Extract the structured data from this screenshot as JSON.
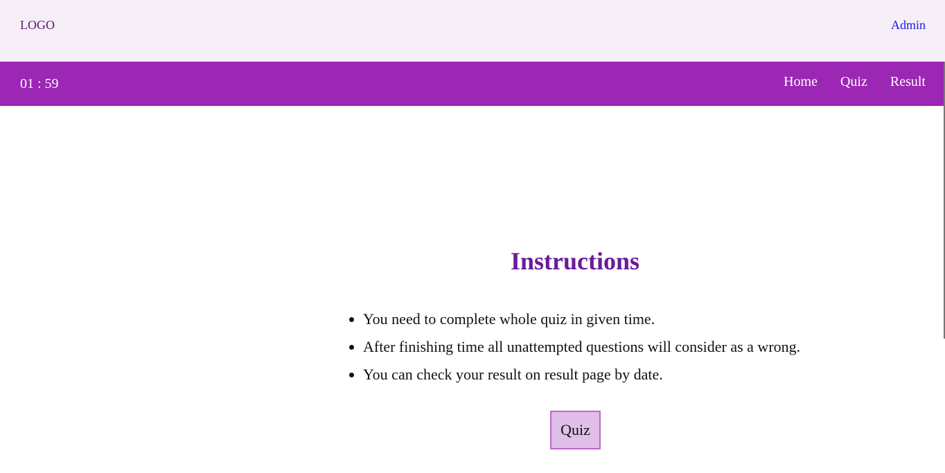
{
  "header": {
    "logo_text": "LOGO",
    "admin_link": "Admin"
  },
  "navbar": {
    "timer": "01 : 59",
    "links": [
      {
        "label": "Home"
      },
      {
        "label": "Quiz"
      },
      {
        "label": "Result"
      }
    ]
  },
  "main": {
    "title": "Instructions",
    "instructions": [
      "You need to complete whole quiz in given time.",
      "After finishing time all unattempted questions will consider as a wrong.",
      "You can check your result on result page by date."
    ],
    "quiz_button": "Quiz"
  },
  "colors": {
    "topbar_bg": "#f6eff8",
    "navbar_bg": "#9c27b4",
    "title": "#6a1b9a",
    "button_bg": "#e1bee7",
    "button_border": "#ba68c8",
    "admin_link": "#1a1ae0"
  }
}
